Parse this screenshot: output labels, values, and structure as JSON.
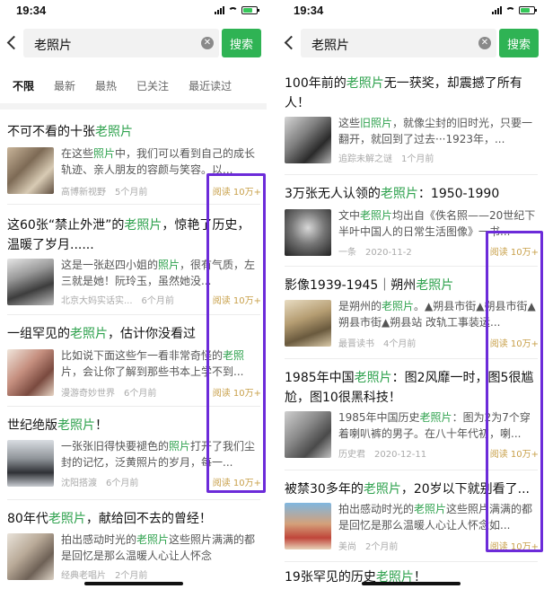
{
  "status_time": "19:34",
  "query": "老照片",
  "search_label": "搜索",
  "filters": [
    "不限",
    "最新",
    "最热",
    "已关注",
    "最近读过"
  ],
  "colors": {
    "accent_green": "#2fb354",
    "keyword": "#2fa24e",
    "read_gold": "#c8a04a",
    "annotation_purple": "#6c2bd9"
  },
  "left_articles": [
    {
      "title_pre": "不可不看的十张",
      "title_hl": "老照片",
      "title_post": "",
      "snip_pre": "在这些",
      "snip_hl": "照片",
      "snip_post": "中，我们可以看到自己的成长轨迹、亲人朋友的容颜与笑容。以...",
      "source": "高博新视野",
      "time": "5个月前",
      "read": "阅读 10万+"
    },
    {
      "title_pre": "这60张“禁止外泄”的",
      "title_hl": "老照片",
      "title_post": "，惊艳了历史，温暖了岁月......",
      "snip_pre": "这是一张赵四小姐的",
      "snip_hl": "照片",
      "snip_post": "，很有气质，左三就是她！阮玲玉，虽然她没...",
      "source": "北京大妈实话实...",
      "time": "6个月前",
      "read": "阅读 10万+"
    },
    {
      "title_pre": "一组罕见的",
      "title_hl": "老照片",
      "title_post": "，估计你没看过",
      "snip_pre": "比如说下面这些乍一看非常奇怪的",
      "snip_hl": "老照",
      "snip_post": "片，会让你了解到那些书本上学不到...",
      "source": "漫游奇妙世界",
      "time": "6个月前",
      "read": "阅读 10万+"
    },
    {
      "title_pre": "世纪绝版",
      "title_hl": "老照片",
      "title_post": "！",
      "snip_pre": "一张张旧得快要褪色的",
      "snip_hl": "照片",
      "snip_post": "打开了我们尘封的记忆，泛黄照片的岁月，每一...",
      "source": "沈阳搭渡",
      "time": "6个月前",
      "read": "阅读 10万+"
    },
    {
      "title_pre": "80年代",
      "title_hl": "老照片",
      "title_post": "，献给回不去的曾经！",
      "snip_pre": "拍出感动时光的",
      "snip_hl": "老照片",
      "snip_post": "这些照片满满的都是回忆是那么温暖人心让人怀念",
      "source": "经典老唱片",
      "time": "2个月前",
      "read": ""
    }
  ],
  "right_articles": [
    {
      "title_pre": "100年前的",
      "title_hl": "老照片",
      "title_post": "无一获奖，却震撼了所有人！",
      "snip_pre": "这些",
      "snip_hl": "旧照片",
      "snip_post": "，就像尘封的旧时光，只要一翻开，就回到了过去···1923年，...",
      "source": "追踪未解之谜",
      "time": "1个月前",
      "read": ""
    },
    {
      "title_pre": "3万张无人认领的",
      "title_hl": "老照片",
      "title_post": "：1950-1990",
      "snip_pre": "文中",
      "snip_hl": "老照片",
      "snip_post": "均出自《佚名照——20世纪下半叶中国人的日常生活图像》一书...",
      "source": "一条",
      "time": "2020-11-2",
      "read": "阅读 10万+"
    },
    {
      "title_pre": "影像1939-1945｜朔州",
      "title_hl": "老照片",
      "title_post": "",
      "snip_pre": "是朔州的",
      "snip_hl": "老照片",
      "snip_post": "。▲朔县市街▲朔县市街▲朔县市街▲朔县站 改轨工事装运...",
      "source": "最晋读书",
      "time": "4个月前",
      "read": "阅读 10万+"
    },
    {
      "title_pre": "1985年中国",
      "title_hl": "老照片",
      "title_post": "：图2风靡一时，图5很尴尬，图10很黑科技！",
      "snip_pre": "1985年中国历史",
      "snip_hl": "老照片",
      "snip_post": "：图为2为7个穿着喇叭裤的男子。在八十年代初，喇...",
      "source": "历史君",
      "time": "2020-12-11",
      "read": "阅读 10万+"
    },
    {
      "title_pre": "被禁30多年的",
      "title_hl": "老照片",
      "title_post": "，20岁以下就别看了...",
      "snip_pre": "拍出感动时光的",
      "snip_hl": "老照片",
      "snip_post": "这些照片满满的都是回忆是那么温暖人心让人怀念如...",
      "source": "美尚",
      "time": "2个月前",
      "read": "阅读 10万+"
    },
    {
      "title_pre": "19张罕见的历史",
      "title_hl": "老照片",
      "title_post": "！",
      "snip_pre": "",
      "snip_hl": "",
      "snip_post": "",
      "source": "",
      "time": "",
      "read": ""
    }
  ]
}
